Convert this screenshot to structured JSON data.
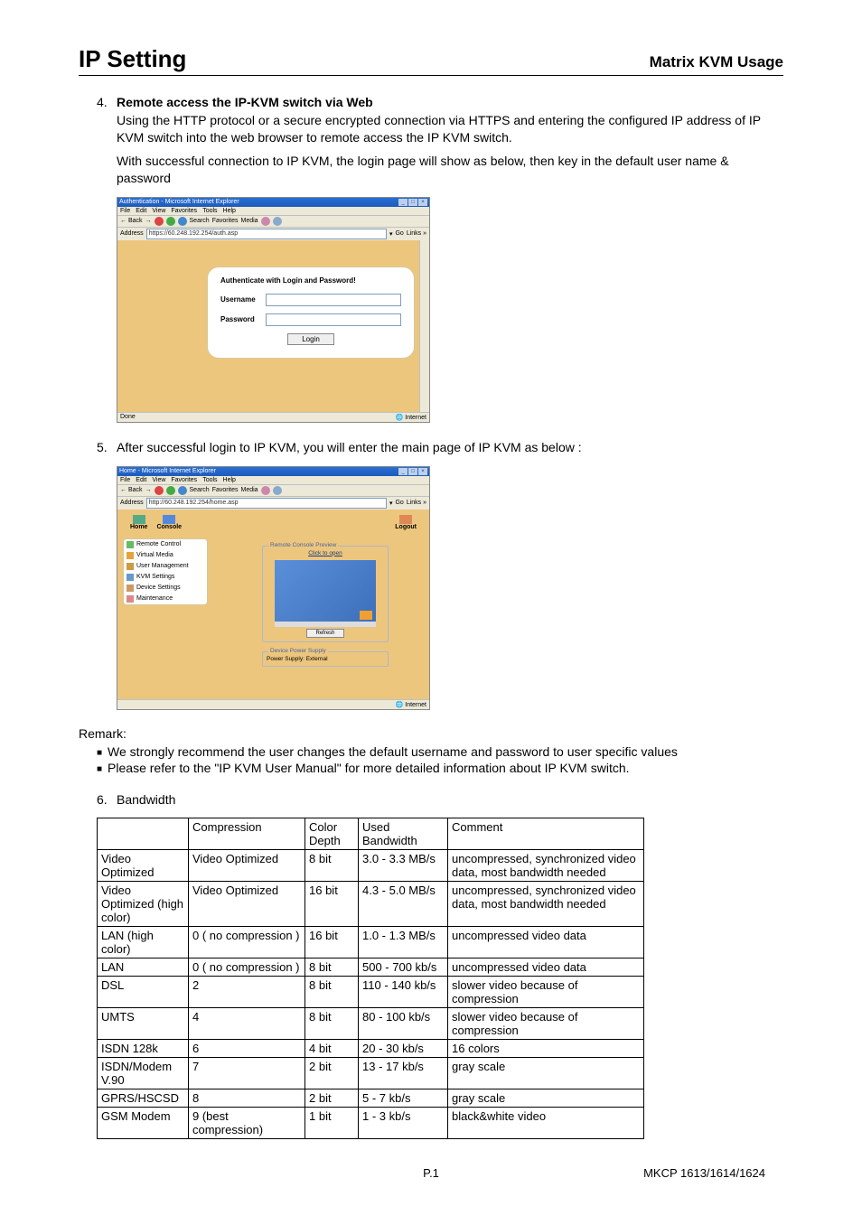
{
  "header": {
    "title": "IP Setting",
    "subtitle": "Matrix KVM Usage"
  },
  "step4": {
    "num": "4.",
    "title": "Remote access the IP-KVM switch via Web",
    "body1": "Using the HTTP protocol or a secure encrypted connection via HTTPS and entering the configured IP address of IP KVM switch into the web browser to remote access the IP KVM switch.",
    "body2": "With successful connection to IP KVM, the login page will show as below, then key in the default user name & password"
  },
  "shot1": {
    "title": "Authentication - Microsoft Internet Explorer",
    "menu": [
      "File",
      "Edit",
      "View",
      "Favorites",
      "Tools",
      "Help"
    ],
    "toolbar_back": "← Back",
    "toolbar_search": "Search",
    "toolbar_fav": "Favorites",
    "toolbar_media": "Media",
    "addr_label": "Address",
    "addr_value": "https://60.248.192.254/auth.asp",
    "go_label": "Go",
    "links_label": "Links »",
    "panel_title": "Authenticate with Login and Password!",
    "username_label": "Username",
    "password_label": "Password",
    "login_btn": "Login",
    "status_left": "Done",
    "status_right": "Internet"
  },
  "step5": {
    "num": "5.",
    "body": "After successful login to IP KVM, you will enter the main page of IP KVM as below :"
  },
  "shot2": {
    "title": "Home - Microsoft Internet Explorer",
    "menu": [
      "File",
      "Edit",
      "View",
      "Favorites",
      "Tools",
      "Help"
    ],
    "toolbar_back": "← Back",
    "toolbar_search": "Search",
    "toolbar_fav": "Favorites",
    "toolbar_media": "Media",
    "addr_label": "Address",
    "addr_value": "http://60.248.192.254/home.asp",
    "go_label": "Go",
    "links_label": "Links »",
    "home_label": "Home",
    "console_label": "Console",
    "logout_label": "Logout",
    "side_items": [
      "Remote Control",
      "Virtual Media",
      "User Management",
      "KVM Settings",
      "Device Settings",
      "Maintenance"
    ],
    "preview_legend": "Remote Console Preview",
    "click_text": "Click to open",
    "refresh_btn": "Refresh",
    "power_legend": "Device Power Supply",
    "power_text": "Power Supply: External",
    "status_right": "Internet"
  },
  "remark": {
    "title": "Remark:",
    "items": [
      "We strongly recommend the user changes the default username and password to user specific values",
      "Please refer to the \"IP KVM User Manual\" for more detailed information about IP KVM switch."
    ]
  },
  "step6": {
    "num": "6.",
    "label": "Bandwidth"
  },
  "table": {
    "headers": [
      "",
      "Compression",
      "Color Depth",
      "Used Bandwidth",
      "Comment"
    ],
    "rows": [
      [
        "Video Optimized",
        "Video Optimized",
        "8 bit",
        "3.0 - 3.3 MB/s",
        "uncompressed, synchronized video data, most bandwidth needed"
      ],
      [
        "Video Optimized (high color)",
        "Video Optimized",
        "16 bit",
        "4.3 - 5.0 MB/s",
        "uncompressed, synchronized video data, most bandwidth needed"
      ],
      [
        "LAN (high color)",
        "0 ( no compression )",
        "16 bit",
        "1.0 - 1.3 MB/s",
        "uncompressed video data"
      ],
      [
        "LAN",
        "0 ( no compression )",
        "8 bit",
        "500 - 700 kb/s",
        "uncompressed video data"
      ],
      [
        "DSL",
        "2",
        "8 bit",
        "110 - 140 kb/s",
        "slower video because of compression"
      ],
      [
        "UMTS",
        "4",
        "8 bit",
        "80   -  100 kb/s",
        "slower video because of compression"
      ],
      [
        "ISDN 128k",
        "6",
        "4 bit",
        "20   -   30 kb/s",
        "16 colors"
      ],
      [
        "ISDN/Modem V.90",
        "7",
        "2 bit",
        "13   -   17 kb/s",
        "gray scale"
      ],
      [
        "GPRS/HSCSD",
        "8",
        "2 bit",
        "5     -     7 kb/s",
        "gray scale"
      ],
      [
        "GSM Modem",
        "9 (best compression)",
        "1 bit",
        "1     -     3 kb/s",
        "black&white video"
      ]
    ]
  },
  "footer": {
    "page": "P.1",
    "model": "MKCP 1613/1614/1624"
  }
}
